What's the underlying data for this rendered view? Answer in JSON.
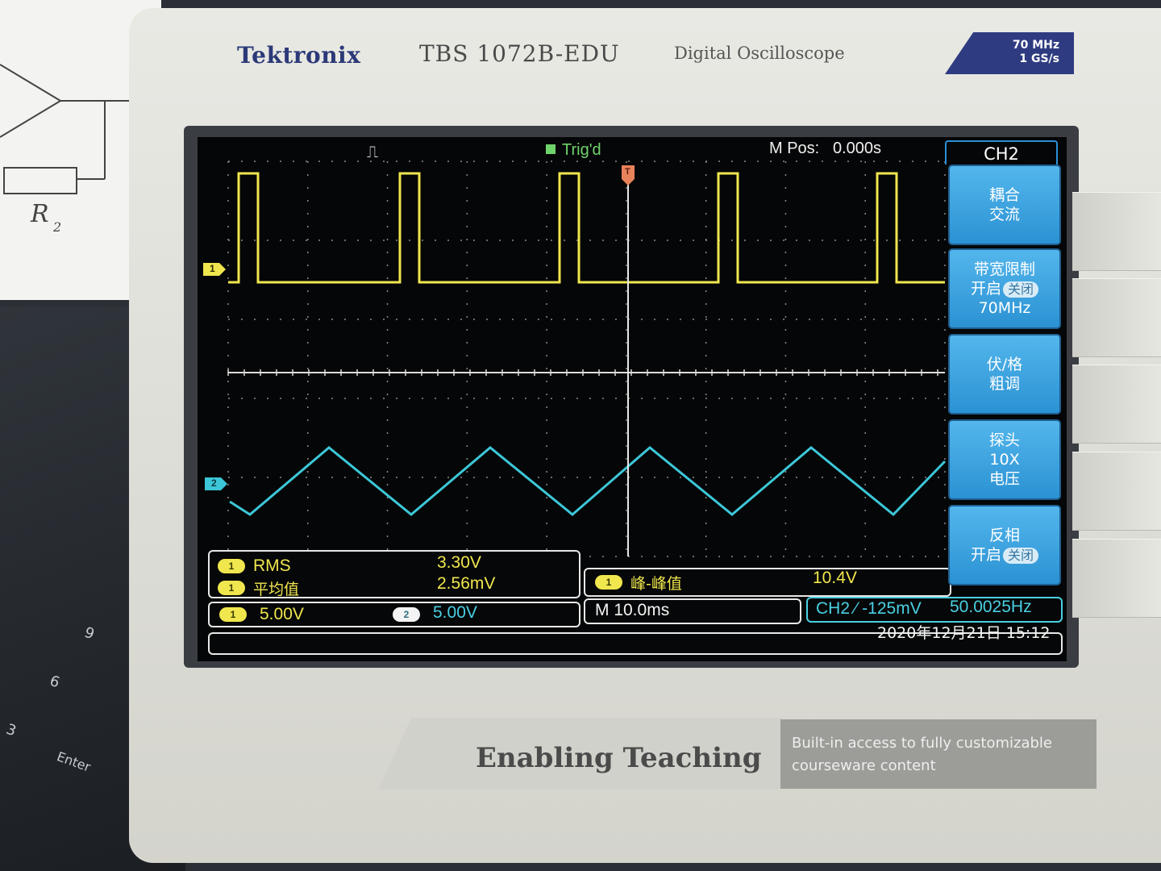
{
  "background": {
    "paper_label": "R",
    "paper_subscript": "2",
    "keys": [
      "9",
      "6",
      "3",
      "Enter"
    ]
  },
  "device": {
    "brand": "Tektronix",
    "model": "TBS 1072B-EDU",
    "type": "Digital Oscilloscope",
    "spec_line1": "70 MHz",
    "spec_line2": "1 GS/s",
    "slogan": "Enabling Teaching",
    "info_line1": "Built-in access to fully customizable",
    "info_line2": "courseware content"
  },
  "screen": {
    "trigger_status": "Trig'd",
    "trigger_glyph": "⎍",
    "mpos_label": "M Pos:",
    "mpos_value": "0.000s",
    "ch1_marker": "1",
    "ch2_marker": "2",
    "trigger_marker": "T",
    "measurements": {
      "rms_label": "RMS",
      "rms_value": "3.30V",
      "mean_label": "平均值",
      "mean_value": "2.56mV",
      "pkpk_label": "峰-峰值",
      "pkpk_value": "10.4V",
      "ch1_badge": "1",
      "ch2_badge": "2"
    },
    "status": {
      "ch1_scale": "5.00V",
      "ch2_scale": "5.00V",
      "timebase": "M 10.0ms",
      "trigger": "CH2 ⁄ -125mV",
      "frequency": "50.0025Hz",
      "datetime": "2020年12月21日 15:12"
    },
    "menu": {
      "title": "CH2",
      "buttons": [
        {
          "line1": "耦合",
          "line2": "交流",
          "line3": ""
        },
        {
          "line1": "带宽限制",
          "line2": "开启",
          "pill": "关闭",
          "line3": "70MHz"
        },
        {
          "line1": "伏/格",
          "line2": "粗调",
          "line3": ""
        },
        {
          "line1": "探头",
          "line2": "10X",
          "line3": "电压"
        },
        {
          "line1": "反相",
          "line2": "开启",
          "pill": "关闭",
          "line3": ""
        }
      ]
    },
    "colors": {
      "ch1": "#f0e64e",
      "ch2": "#3cc7d8",
      "menu": "#3aa2e0",
      "trig": "#6fd36b"
    }
  }
}
